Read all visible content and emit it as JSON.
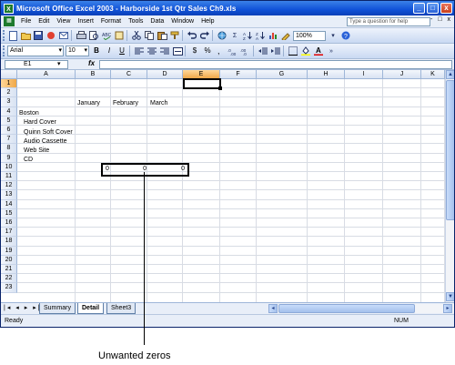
{
  "window": {
    "title": "Microsoft Office Excel 2003 - Harborside 1st Qtr Sales Ch9.xls",
    "app_icon_glyph": "X",
    "controls": [
      "_",
      "□",
      "x"
    ]
  },
  "menu": {
    "items": [
      "File",
      "Edit",
      "View",
      "Insert",
      "Format",
      "Tools",
      "Data",
      "Window",
      "Help"
    ],
    "help_placeholder": "Type a question for help",
    "doc_controls": "- □ x"
  },
  "toolbar": {
    "zoom": "100%",
    "font_name": "Arial",
    "font_size": "10",
    "sigma": "Σ",
    "currency": "$",
    "percent": "%"
  },
  "formula_bar": {
    "name_box": "E1",
    "fx": "fx",
    "value": ""
  },
  "sheet": {
    "columns": [
      "A",
      "B",
      "C",
      "D",
      "E",
      "F",
      "G",
      "H",
      "I",
      "J",
      "K"
    ],
    "active_column": "E",
    "rows": [
      "1",
      "2",
      "3",
      "4",
      "5",
      "6",
      "7",
      "8",
      "9",
      "10",
      "11",
      "12",
      "13",
      "14",
      "15",
      "16",
      "17",
      "18",
      "19",
      "20",
      "21",
      "22",
      "23"
    ],
    "active_row": "1",
    "cells": {
      "B3": "January",
      "C3": "February",
      "D3": "March",
      "A4": "Boston",
      "A5": "Hard Cover",
      "A6": "Quinn Soft Cover",
      "A7": "Audio Cassette",
      "A8": "Web Site",
      "A9": "CD",
      "B10": "0",
      "C10": "0",
      "D10": "0"
    }
  },
  "tabs": {
    "nav": "|◂ ◂ ▸ ▸|",
    "sheets": [
      "Summary",
      "Detail",
      "Sheet3"
    ],
    "active": "Detail"
  },
  "status": {
    "left": "Ready",
    "num": "NUM"
  },
  "callout": {
    "label": "Unwanted zeros"
  }
}
